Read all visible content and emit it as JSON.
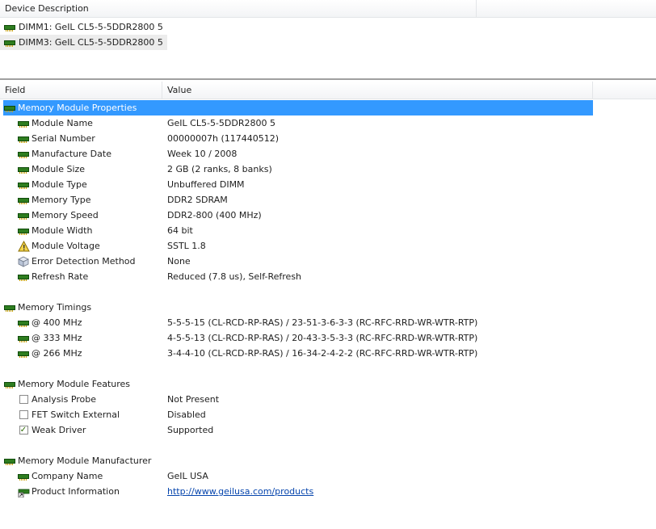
{
  "top_header": {
    "col1": "Device Description"
  },
  "devices": [
    {
      "label": "DIMM1: GeIL CL5-5-5DDR2800  5"
    },
    {
      "label": "DIMM3: GeIL CL5-5-5DDR2800  5"
    }
  ],
  "bottom_header": {
    "field": "Field",
    "value": "Value"
  },
  "groups": [
    {
      "title": "Memory Module Properties",
      "rows": [
        {
          "field": "Module Name",
          "value": "GeIL CL5-5-5DDR2800  5"
        },
        {
          "field": "Serial Number",
          "value": "00000007h (117440512)"
        },
        {
          "field": "Manufacture Date",
          "value": "Week 10 / 2008"
        },
        {
          "field": "Module Size",
          "value": "2 GB (2 ranks, 8 banks)"
        },
        {
          "field": "Module Type",
          "value": "Unbuffered DIMM"
        },
        {
          "field": "Memory Type",
          "value": "DDR2 SDRAM"
        },
        {
          "field": "Memory Speed",
          "value": "DDR2-800 (400 MHz)"
        },
        {
          "field": "Module Width",
          "value": "64 bit"
        },
        {
          "field": "Module Voltage",
          "value": "SSTL 1.8"
        },
        {
          "field": "Error Detection Method",
          "value": "None"
        },
        {
          "field": "Refresh Rate",
          "value": "Reduced (7.8 us), Self-Refresh"
        }
      ]
    },
    {
      "title": "Memory Timings",
      "rows": [
        {
          "field": "@ 400 MHz",
          "value": "5-5-5-15  (CL-RCD-RP-RAS) / 23-51-3-6-3-3  (RC-RFC-RRD-WR-WTR-RTP)"
        },
        {
          "field": "@ 333 MHz",
          "value": "4-5-5-13  (CL-RCD-RP-RAS) / 20-43-3-5-3-3  (RC-RFC-RRD-WR-WTR-RTP)"
        },
        {
          "field": "@ 266 MHz",
          "value": "3-4-4-10  (CL-RCD-RP-RAS) / 16-34-2-4-2-2  (RC-RFC-RRD-WR-WTR-RTP)"
        }
      ]
    },
    {
      "title": "Memory Module Features",
      "rows": [
        {
          "field": "Analysis Probe",
          "value": "Not Present",
          "checked": false
        },
        {
          "field": "FET Switch External",
          "value": "Disabled",
          "checked": false
        },
        {
          "field": "Weak Driver",
          "value": "Supported",
          "checked": true
        }
      ]
    },
    {
      "title": "Memory Module Manufacturer",
      "rows": [
        {
          "field": "Company Name",
          "value": "GeIL USA"
        },
        {
          "field": "Product Information",
          "value": "http://www.geilusa.com/products"
        }
      ]
    }
  ],
  "icons": {
    "module": "ram-module-icon",
    "voltage": "warning-icon",
    "error_detection": "cube-icon",
    "checkbox": "checkbox-icon",
    "link": "ram-link-icon"
  },
  "colors": {
    "selection": "#3399ff",
    "link": "#0645ad",
    "device_selection": "#ececec"
  }
}
